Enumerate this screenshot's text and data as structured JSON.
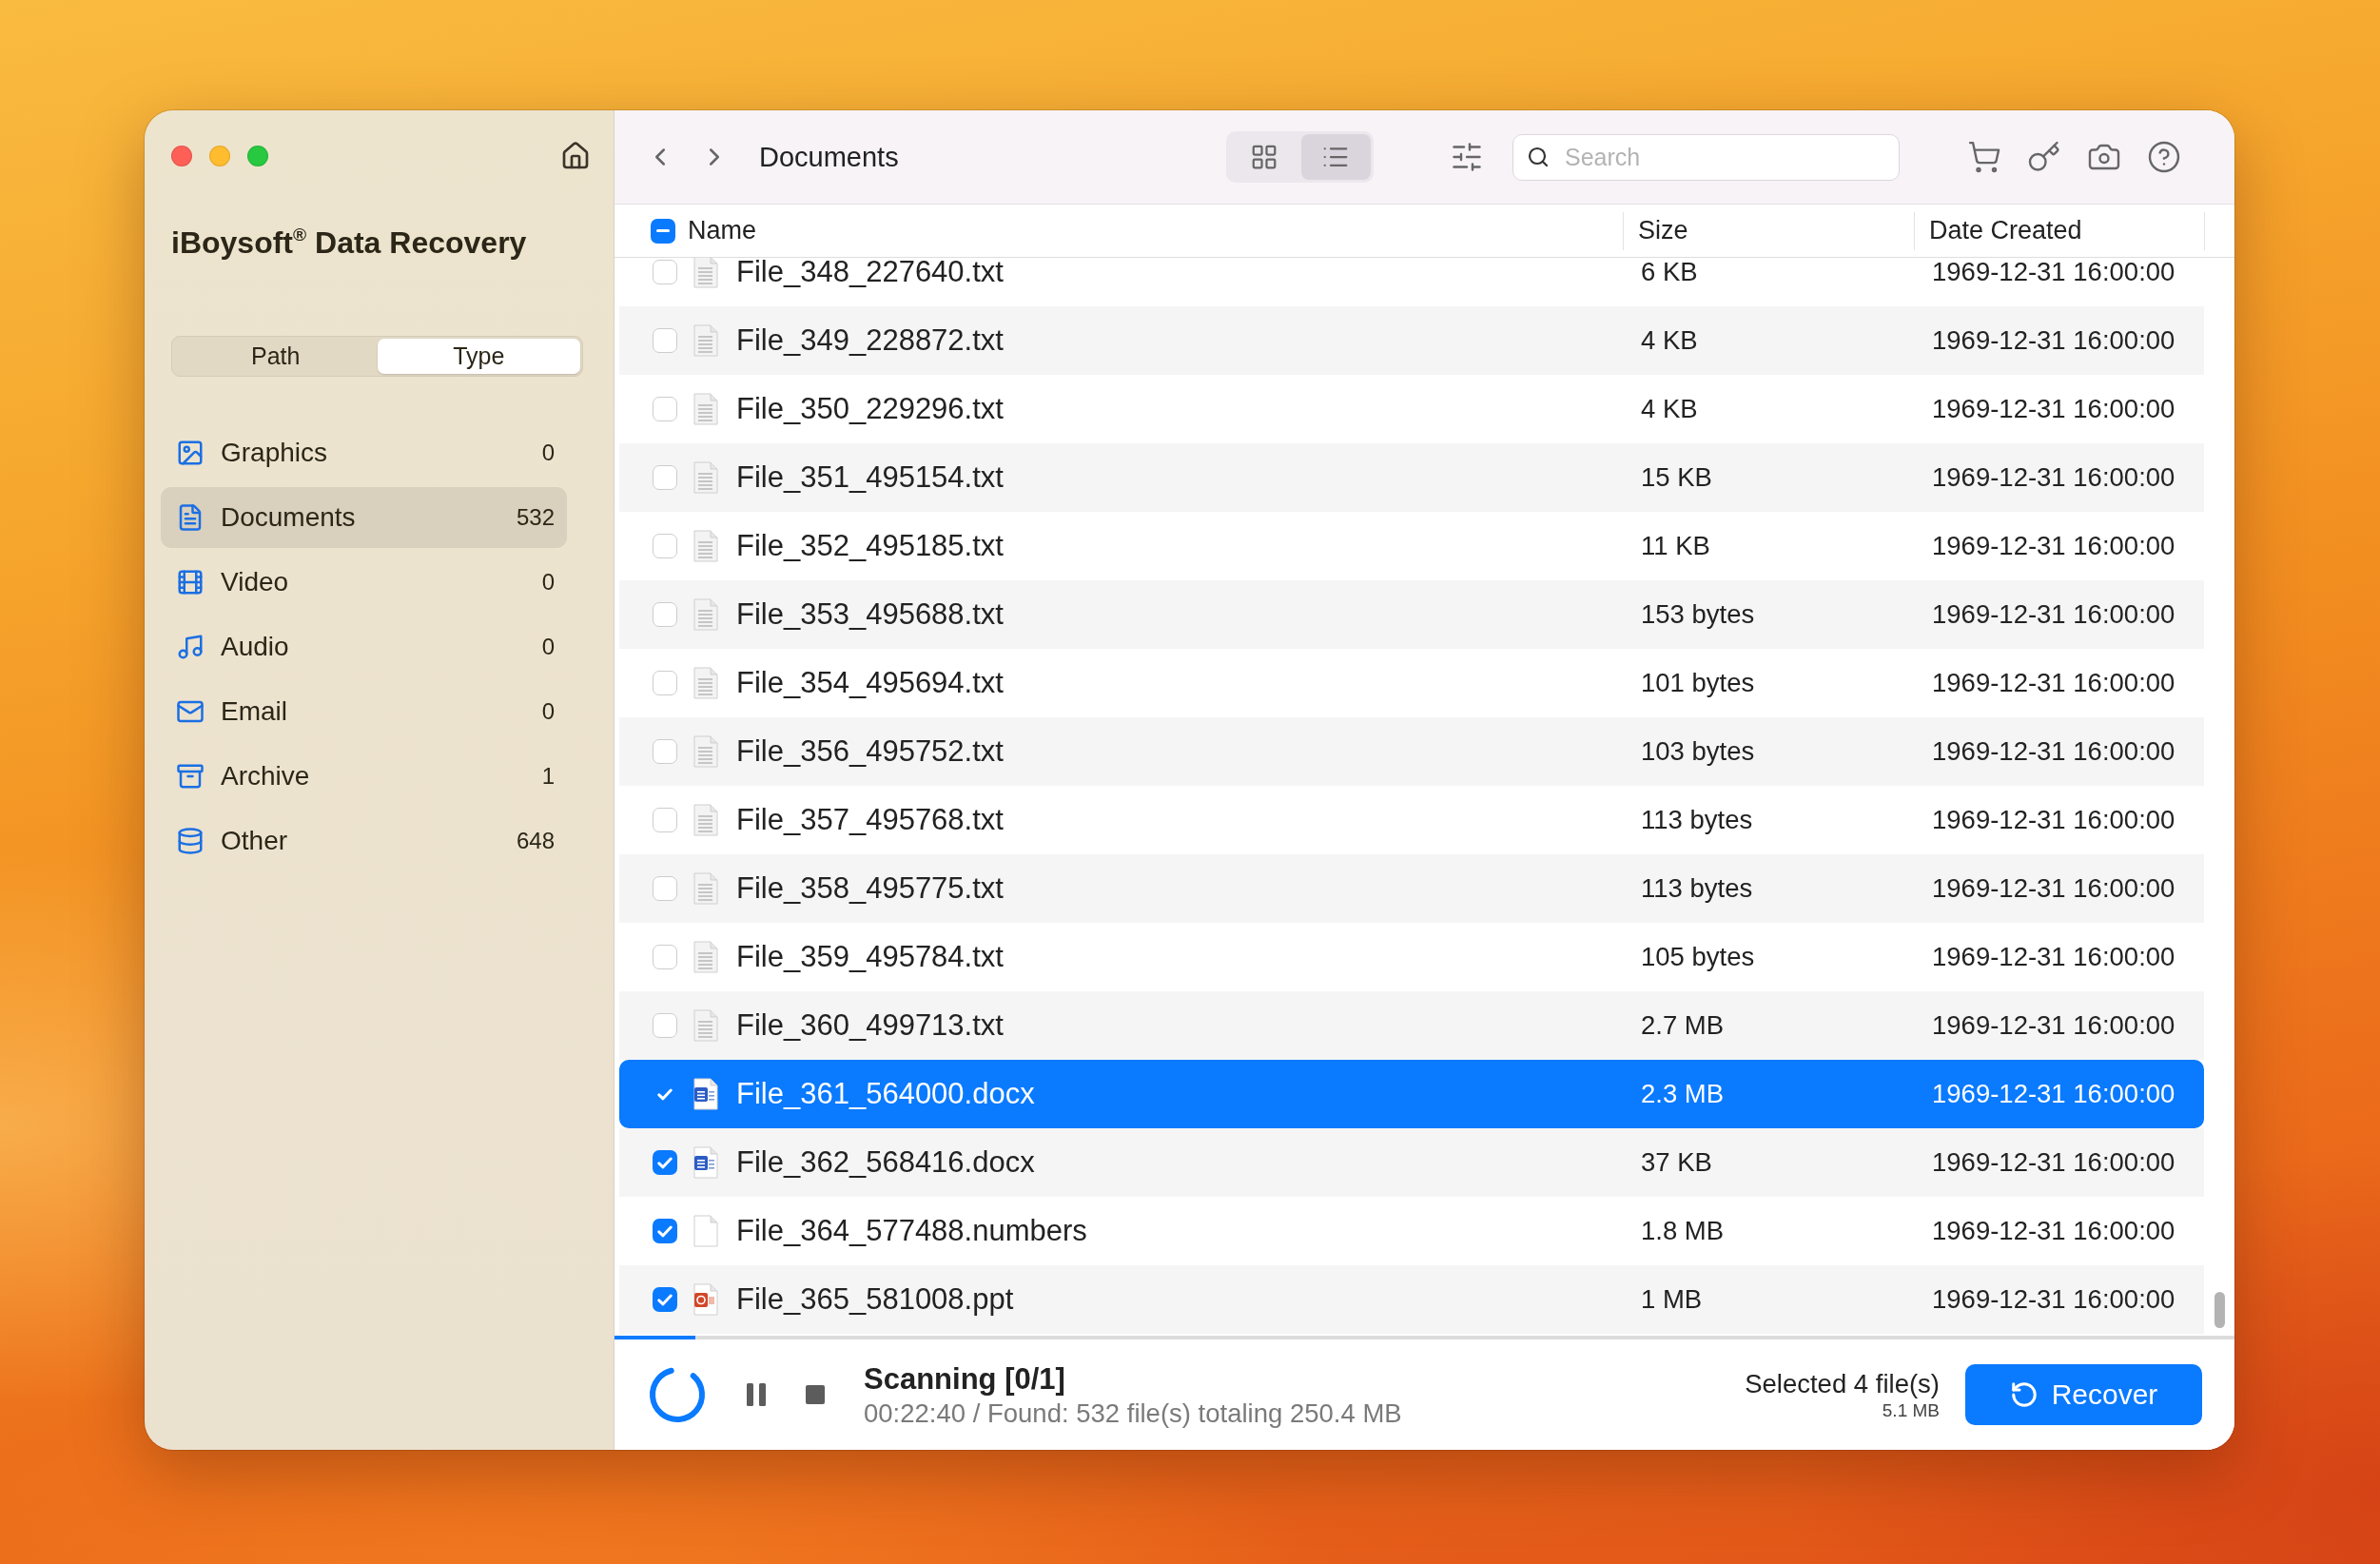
{
  "sidebar": {
    "app_title": "iBoysoft$^{®}$ Data Recovery",
    "view_tabs": [
      {
        "label": "Path",
        "selected": false
      },
      {
        "label": "Type",
        "selected": true
      }
    ],
    "items": [
      {
        "kind": "graphics",
        "label": "Graphics",
        "count": "0",
        "selected": false
      },
      {
        "kind": "documents",
        "label": "Documents",
        "count": "532",
        "selected": true
      },
      {
        "kind": "video",
        "label": "Video",
        "count": "0",
        "selected": false
      },
      {
        "kind": "audio",
        "label": "Audio",
        "count": "0",
        "selected": false
      },
      {
        "kind": "email",
        "label": "Email",
        "count": "0",
        "selected": false
      },
      {
        "kind": "archive",
        "label": "Archive",
        "count": "1",
        "selected": false
      },
      {
        "kind": "other",
        "label": "Other",
        "count": "648",
        "selected": false
      }
    ]
  },
  "toolbar": {
    "location": "Documents",
    "view_modes": [
      {
        "kind": "grid",
        "selected": false
      },
      {
        "kind": "list",
        "selected": true
      }
    ],
    "search": {
      "placeholder": "Search"
    }
  },
  "table": {
    "select_all": {
      "indeterminate": true
    },
    "columns": [
      {
        "label": "Name"
      },
      {
        "label": "Size"
      },
      {
        "label": "Date Created"
      }
    ],
    "rows": [
      {
        "kind": "txt",
        "name": "File_348_227640.txt",
        "size": "6 KB",
        "date": "1969-12-31 16:00:00",
        "checked": false,
        "selected": false
      },
      {
        "kind": "txt",
        "name": "File_349_228872.txt",
        "size": "4 KB",
        "date": "1969-12-31 16:00:00",
        "checked": false,
        "selected": false
      },
      {
        "kind": "txt",
        "name": "File_350_229296.txt",
        "size": "4 KB",
        "date": "1969-12-31 16:00:00",
        "checked": false,
        "selected": false
      },
      {
        "kind": "txt",
        "name": "File_351_495154.txt",
        "size": "15 KB",
        "date": "1969-12-31 16:00:00",
        "checked": false,
        "selected": false
      },
      {
        "kind": "txt",
        "name": "File_352_495185.txt",
        "size": "11 KB",
        "date": "1969-12-31 16:00:00",
        "checked": false,
        "selected": false
      },
      {
        "kind": "txt",
        "name": "File_353_495688.txt",
        "size": "153 bytes",
        "date": "1969-12-31 16:00:00",
        "checked": false,
        "selected": false
      },
      {
        "kind": "txt",
        "name": "File_354_495694.txt",
        "size": "101 bytes",
        "date": "1969-12-31 16:00:00",
        "checked": false,
        "selected": false
      },
      {
        "kind": "txt",
        "name": "File_356_495752.txt",
        "size": "103 bytes",
        "date": "1969-12-31 16:00:00",
        "checked": false,
        "selected": false
      },
      {
        "kind": "txt",
        "name": "File_357_495768.txt",
        "size": "113 bytes",
        "date": "1969-12-31 16:00:00",
        "checked": false,
        "selected": false
      },
      {
        "kind": "txt",
        "name": "File_358_495775.txt",
        "size": "113 bytes",
        "date": "1969-12-31 16:00:00",
        "checked": false,
        "selected": false
      },
      {
        "kind": "txt",
        "name": "File_359_495784.txt",
        "size": "105 bytes",
        "date": "1969-12-31 16:00:00",
        "checked": false,
        "selected": false
      },
      {
        "kind": "txt",
        "name": "File_360_499713.txt",
        "size": "2.7 MB",
        "date": "1969-12-31 16:00:00",
        "checked": false,
        "selected": false
      },
      {
        "kind": "docx",
        "name": "File_361_564000.docx",
        "size": "2.3 MB",
        "date": "1969-12-31 16:00:00",
        "checked": true,
        "selected": true
      },
      {
        "kind": "docx",
        "name": "File_362_568416.docx",
        "size": "37 KB",
        "date": "1969-12-31 16:00:00",
        "checked": true,
        "selected": false
      },
      {
        "kind": "numbers",
        "name": "File_364_577488.numbers",
        "size": "1.8 MB",
        "date": "1969-12-31 16:00:00",
        "checked": true,
        "selected": false
      },
      {
        "kind": "ppt",
        "name": "File_365_581008.ppt",
        "size": "1 MB",
        "date": "1969-12-31 16:00:00",
        "checked": true,
        "selected": false
      }
    ]
  },
  "status_bar": {
    "progress": {
      "level": 0.05
    },
    "title": "Scanning [0/1]",
    "detail": "00:22:40 / Found: 532 file(s) totaling 250.4 MB",
    "selection": "Selected 4 file(s)",
    "selection_size": "5.1 MB",
    "recover_button": {
      "label": "Recover"
    }
  }
}
